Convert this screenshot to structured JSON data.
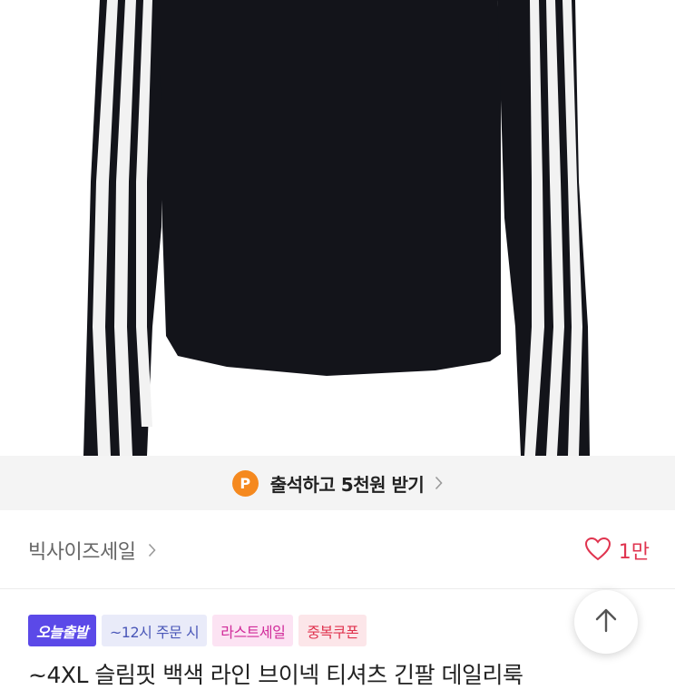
{
  "banner": {
    "badge_letter": "P",
    "text": "출석하고 5천원 받기"
  },
  "category": {
    "label": "빅사이즈세일"
  },
  "likes": {
    "count": "1만"
  },
  "badges": [
    {
      "label": "오늘출발"
    },
    {
      "label": "~12시 주문 시"
    },
    {
      "label": "라스트세일"
    },
    {
      "label": "중복쿠폰"
    }
  ],
  "product": {
    "title": "~4XL 슬림핏 백색 라인 브이넥 티셔츠 긴팔 데일리룩"
  },
  "colors": {
    "accent": "#5b49e8",
    "like": "#e0344f",
    "point": "#f5891f"
  },
  "icons": {
    "banner_chevron": "chevron-right-icon",
    "category_chevron": "chevron-right-icon",
    "like": "heart-outline-icon",
    "scroll_top": "arrow-up-icon"
  }
}
